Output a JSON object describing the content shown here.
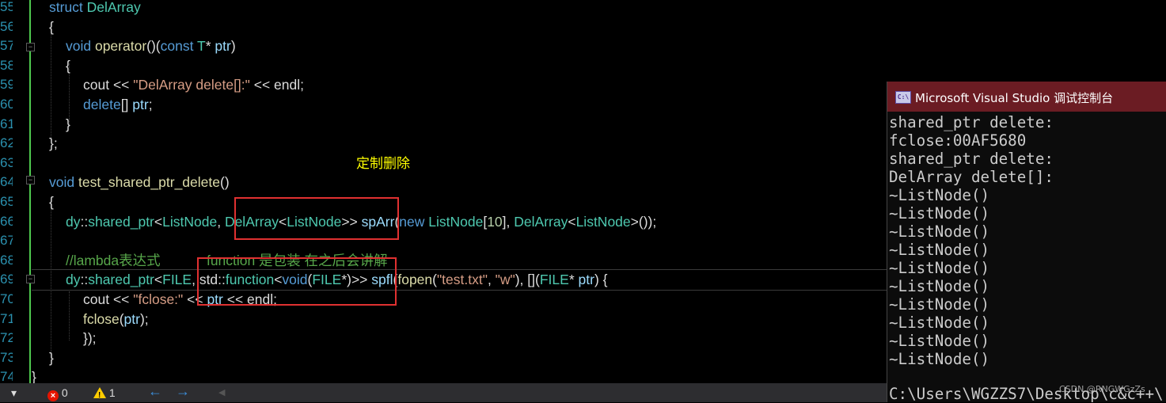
{
  "editor": {
    "line_numbers": [
      "55",
      "56",
      "57",
      "58",
      "59",
      "60",
      "61",
      "62",
      "63",
      "64",
      "65",
      "66",
      "67",
      "68",
      "69",
      "70",
      "71",
      "72",
      "73",
      "74"
    ],
    "lines": {
      "l55": [
        [
          "k",
          "struct "
        ],
        [
          "t",
          "DelArray"
        ]
      ],
      "l56": [
        [
          "p",
          "{"
        ]
      ],
      "l57": [
        [
          "k",
          "void "
        ],
        [
          "f",
          "operator"
        ],
        [
          "p",
          "()("
        ],
        [
          "k",
          "const "
        ],
        [
          "t",
          "T"
        ],
        [
          "p",
          "* "
        ],
        [
          "v",
          "ptr"
        ],
        [
          "p",
          ")"
        ]
      ],
      "l58": [
        [
          "p",
          "{"
        ]
      ],
      "l59": [
        [
          "p",
          "cout << "
        ],
        [
          "s",
          "\"DelArray delete[]:\""
        ],
        [
          "p",
          " << endl;"
        ]
      ],
      "l60": [
        [
          "k",
          "delete"
        ],
        [
          "p",
          "[] "
        ],
        [
          "v",
          "ptr"
        ],
        [
          "p",
          ";"
        ]
      ],
      "l61": [
        [
          "p",
          "}"
        ]
      ],
      "l62": [
        [
          "p",
          "};"
        ]
      ],
      "l63": [
        [
          "p",
          ""
        ]
      ],
      "l64": [
        [
          "k",
          "void "
        ],
        [
          "f",
          "test_shared_ptr_delete"
        ],
        [
          "p",
          "()"
        ]
      ],
      "l65": [
        [
          "p",
          "{"
        ]
      ],
      "l66": [
        [
          "t",
          "dy"
        ],
        [
          "p",
          "::"
        ],
        [
          "t",
          "shared_ptr"
        ],
        [
          "p",
          "<"
        ],
        [
          "t",
          "ListNode"
        ],
        [
          "p",
          ", "
        ],
        [
          "t",
          "DelArray"
        ],
        [
          "p",
          "<"
        ],
        [
          "t",
          "ListNode"
        ],
        [
          "p",
          ">> "
        ],
        [
          "v",
          "spArr"
        ],
        [
          "p",
          "("
        ],
        [
          "k",
          "new "
        ],
        [
          "t",
          "ListNode"
        ],
        [
          "p",
          "["
        ],
        [
          "n",
          "10"
        ],
        [
          "p",
          "], "
        ],
        [
          "t",
          "DelArray"
        ],
        [
          "p",
          "<"
        ],
        [
          "t",
          "ListNode"
        ],
        [
          "p",
          ">());"
        ]
      ],
      "l67": [
        [
          "p",
          ""
        ]
      ],
      "l68": [
        [
          "c",
          "//lambda表达式            function 是包装 在之后会讲解"
        ]
      ],
      "l69": [
        [
          "t",
          "dy"
        ],
        [
          "p",
          "::"
        ],
        [
          "t",
          "shared_ptr"
        ],
        [
          "p",
          "<"
        ],
        [
          "t",
          "FILE"
        ],
        [
          "p",
          ", std::"
        ],
        [
          "t",
          "function"
        ],
        [
          "p",
          "<"
        ],
        [
          "k",
          "void"
        ],
        [
          "p",
          "("
        ],
        [
          "t",
          "FILE"
        ],
        [
          "p",
          "*)>> "
        ],
        [
          "v",
          "spfl"
        ],
        [
          "p",
          "("
        ],
        [
          "f",
          "fopen"
        ],
        [
          "p",
          "("
        ],
        [
          "s",
          "\"test.txt\""
        ],
        [
          "p",
          ", "
        ],
        [
          "s",
          "\"w\""
        ],
        [
          "p",
          "), []("
        ],
        [
          "t",
          "FILE"
        ],
        [
          "p",
          "* "
        ],
        [
          "v",
          "ptr"
        ],
        [
          "p",
          ") {"
        ]
      ],
      "l70": [
        [
          "p",
          "cout << "
        ],
        [
          "s",
          "\"fclose:\""
        ],
        [
          "p",
          " << "
        ],
        [
          "v",
          "ptr"
        ],
        [
          "p",
          " << endl;"
        ]
      ],
      "l71": [
        [
          "f",
          "fclose"
        ],
        [
          "p",
          "("
        ],
        [
          "v",
          "ptr"
        ],
        [
          "p",
          ");"
        ]
      ],
      "l72": [
        [
          "p",
          "});"
        ]
      ],
      "l73": [
        [
          "p",
          "}"
        ]
      ],
      "l74": [
        [
          "p",
          "}"
        ]
      ]
    },
    "annotation": "定制删除"
  },
  "status": {
    "errors": "0",
    "warnings": "1",
    "dropdown": "▾"
  },
  "console": {
    "title": "Microsoft Visual Studio 调试控制台",
    "icon_text": "C:\\",
    "output": "shared_ptr delete:\nfclose:00AF5680\nshared_ptr delete:\nDelArray delete[]:\n~ListNode()\n~ListNode()\n~ListNode()\n~ListNode()\n~ListNode()\n~ListNode()\n~ListNode()\n~ListNode()\n~ListNode()\n~ListNode()",
    "path_line": "C:\\Users\\WGZZS7\\Desktop\\c&c++\\"
  },
  "watermark": "CSDN @RNGWGzZs",
  "colors": {
    "editor_bg": "#000000",
    "keyword": "#569cd6",
    "type": "#4ec9b0",
    "string": "#d69d85",
    "comment": "#57a64a",
    "highlight_box": "#e03131",
    "annotation": "#ffff00",
    "console_title_bg": "#6b1c23"
  }
}
